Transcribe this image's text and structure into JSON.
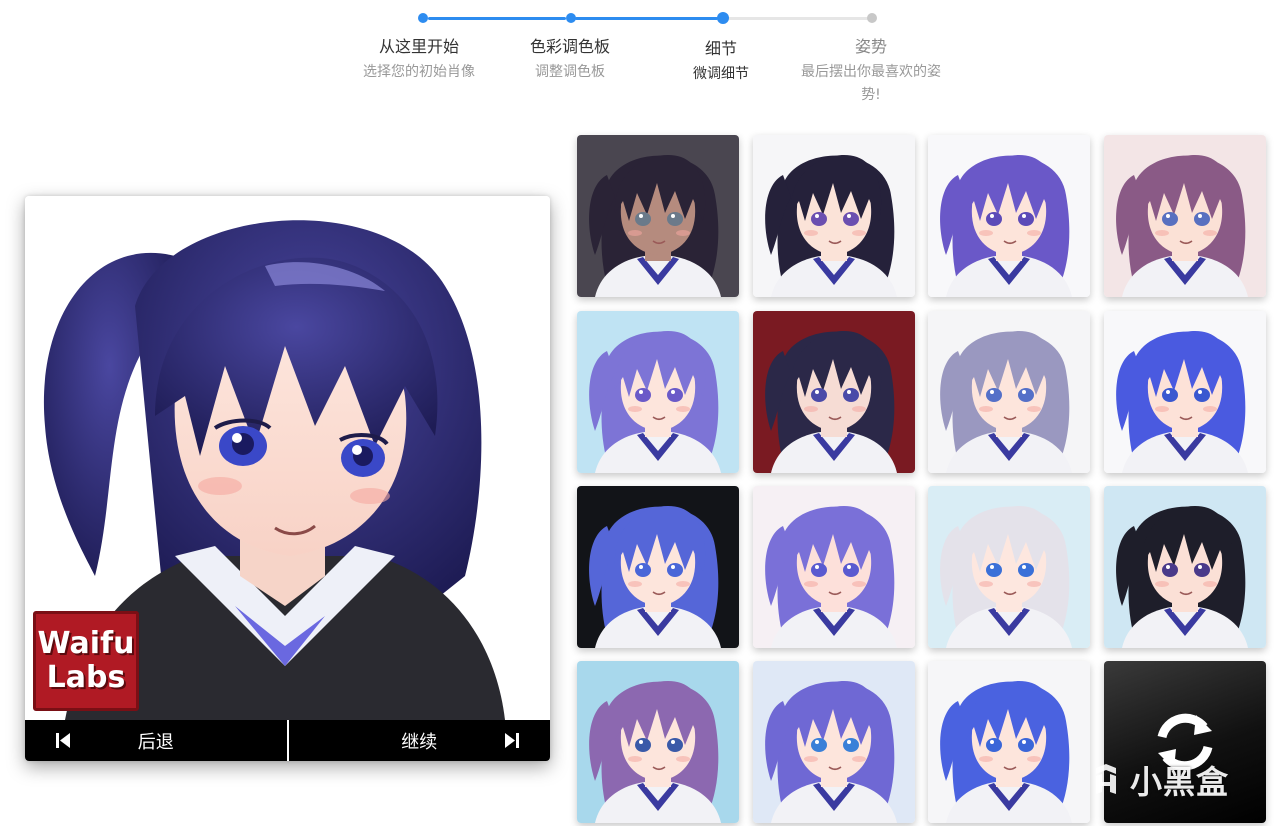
{
  "stepper": {
    "steps": [
      {
        "title": "从这里开始",
        "subtitle": "选择您的初始肖像",
        "state": "done"
      },
      {
        "title": "色彩调色板",
        "subtitle": "调整调色板",
        "state": "done"
      },
      {
        "title": "细节",
        "subtitle": "微调细节",
        "state": "current"
      },
      {
        "title": "姿势",
        "subtitle_line1": "最后摆出你最喜欢的姿",
        "subtitle_line2": "势!",
        "state": "pending"
      }
    ],
    "active_color": "#2d8cf0",
    "pending_color": "#e0e0e0"
  },
  "preview": {
    "logo_line1": "Waifu",
    "logo_line2": "Labs",
    "back_label": "后退",
    "next_label": "继续",
    "hair_color": "#2c2a6e"
  },
  "grid": {
    "tiles": [
      {
        "hair": "#2a2336",
        "bg": "#4a4650",
        "skin": "#b58b7e",
        "eye": "#6b7a8a"
      },
      {
        "hair": "#25213a",
        "bg": "#f6f6f8",
        "skin": "#fbe3d8",
        "eye": "#6b4fb0"
      },
      {
        "hair": "#6a58c8",
        "bg": "#f8f8fa",
        "skin": "#fde4da",
        "eye": "#5c4ab8"
      },
      {
        "hair": "#8a5a86",
        "bg": "#f3e5e6",
        "skin": "#fbe1d6",
        "eye": "#5870c0"
      },
      {
        "hair": "#7d74d6",
        "bg": "#bfe3f3",
        "skin": "#fde5dc",
        "eye": "#6a5ac8"
      },
      {
        "hair": "#2b2848",
        "bg": "#7a1a22",
        "skin": "#f6dcd4",
        "eye": "#4a4aa8"
      },
      {
        "hair": "#9a98c0",
        "bg": "#f5f5f7",
        "skin": "#fde5dc",
        "eye": "#5470c8"
      },
      {
        "hair": "#4a5ae0",
        "bg": "#f8f8fa",
        "skin": "#fde2d8",
        "eye": "#3a58d0"
      },
      {
        "hair": "#5566d8",
        "bg": "#121418",
        "skin": "#fde5dc",
        "eye": "#4a66d8"
      },
      {
        "hair": "#7a70d8",
        "bg": "#f6f0f4",
        "skin": "#fde0da",
        "eye": "#5a5ad0"
      },
      {
        "hair": "#e4e2ea",
        "bg": "#d9edf5",
        "skin": "#fde7df",
        "eye": "#3a70d8"
      },
      {
        "hair": "#1e1e2a",
        "bg": "#cfe7f3",
        "skin": "#fbe0d6",
        "eye": "#4a3a8a"
      },
      {
        "hair": "#8c68b0",
        "bg": "#a8d8ec",
        "skin": "#fde5dc",
        "eye": "#3a5aa8"
      },
      {
        "hair": "#6f68d4",
        "bg": "#dfe8f6",
        "skin": "#fde5dc",
        "eye": "#3a80d8"
      },
      {
        "hair": "#4a62e0",
        "bg": "#f6f6f8",
        "skin": "#fde5dc",
        "eye": "#3a66d8"
      }
    ]
  },
  "refresh": {
    "icon": "refresh-icon"
  },
  "watermark": {
    "text": "小黑盒"
  }
}
